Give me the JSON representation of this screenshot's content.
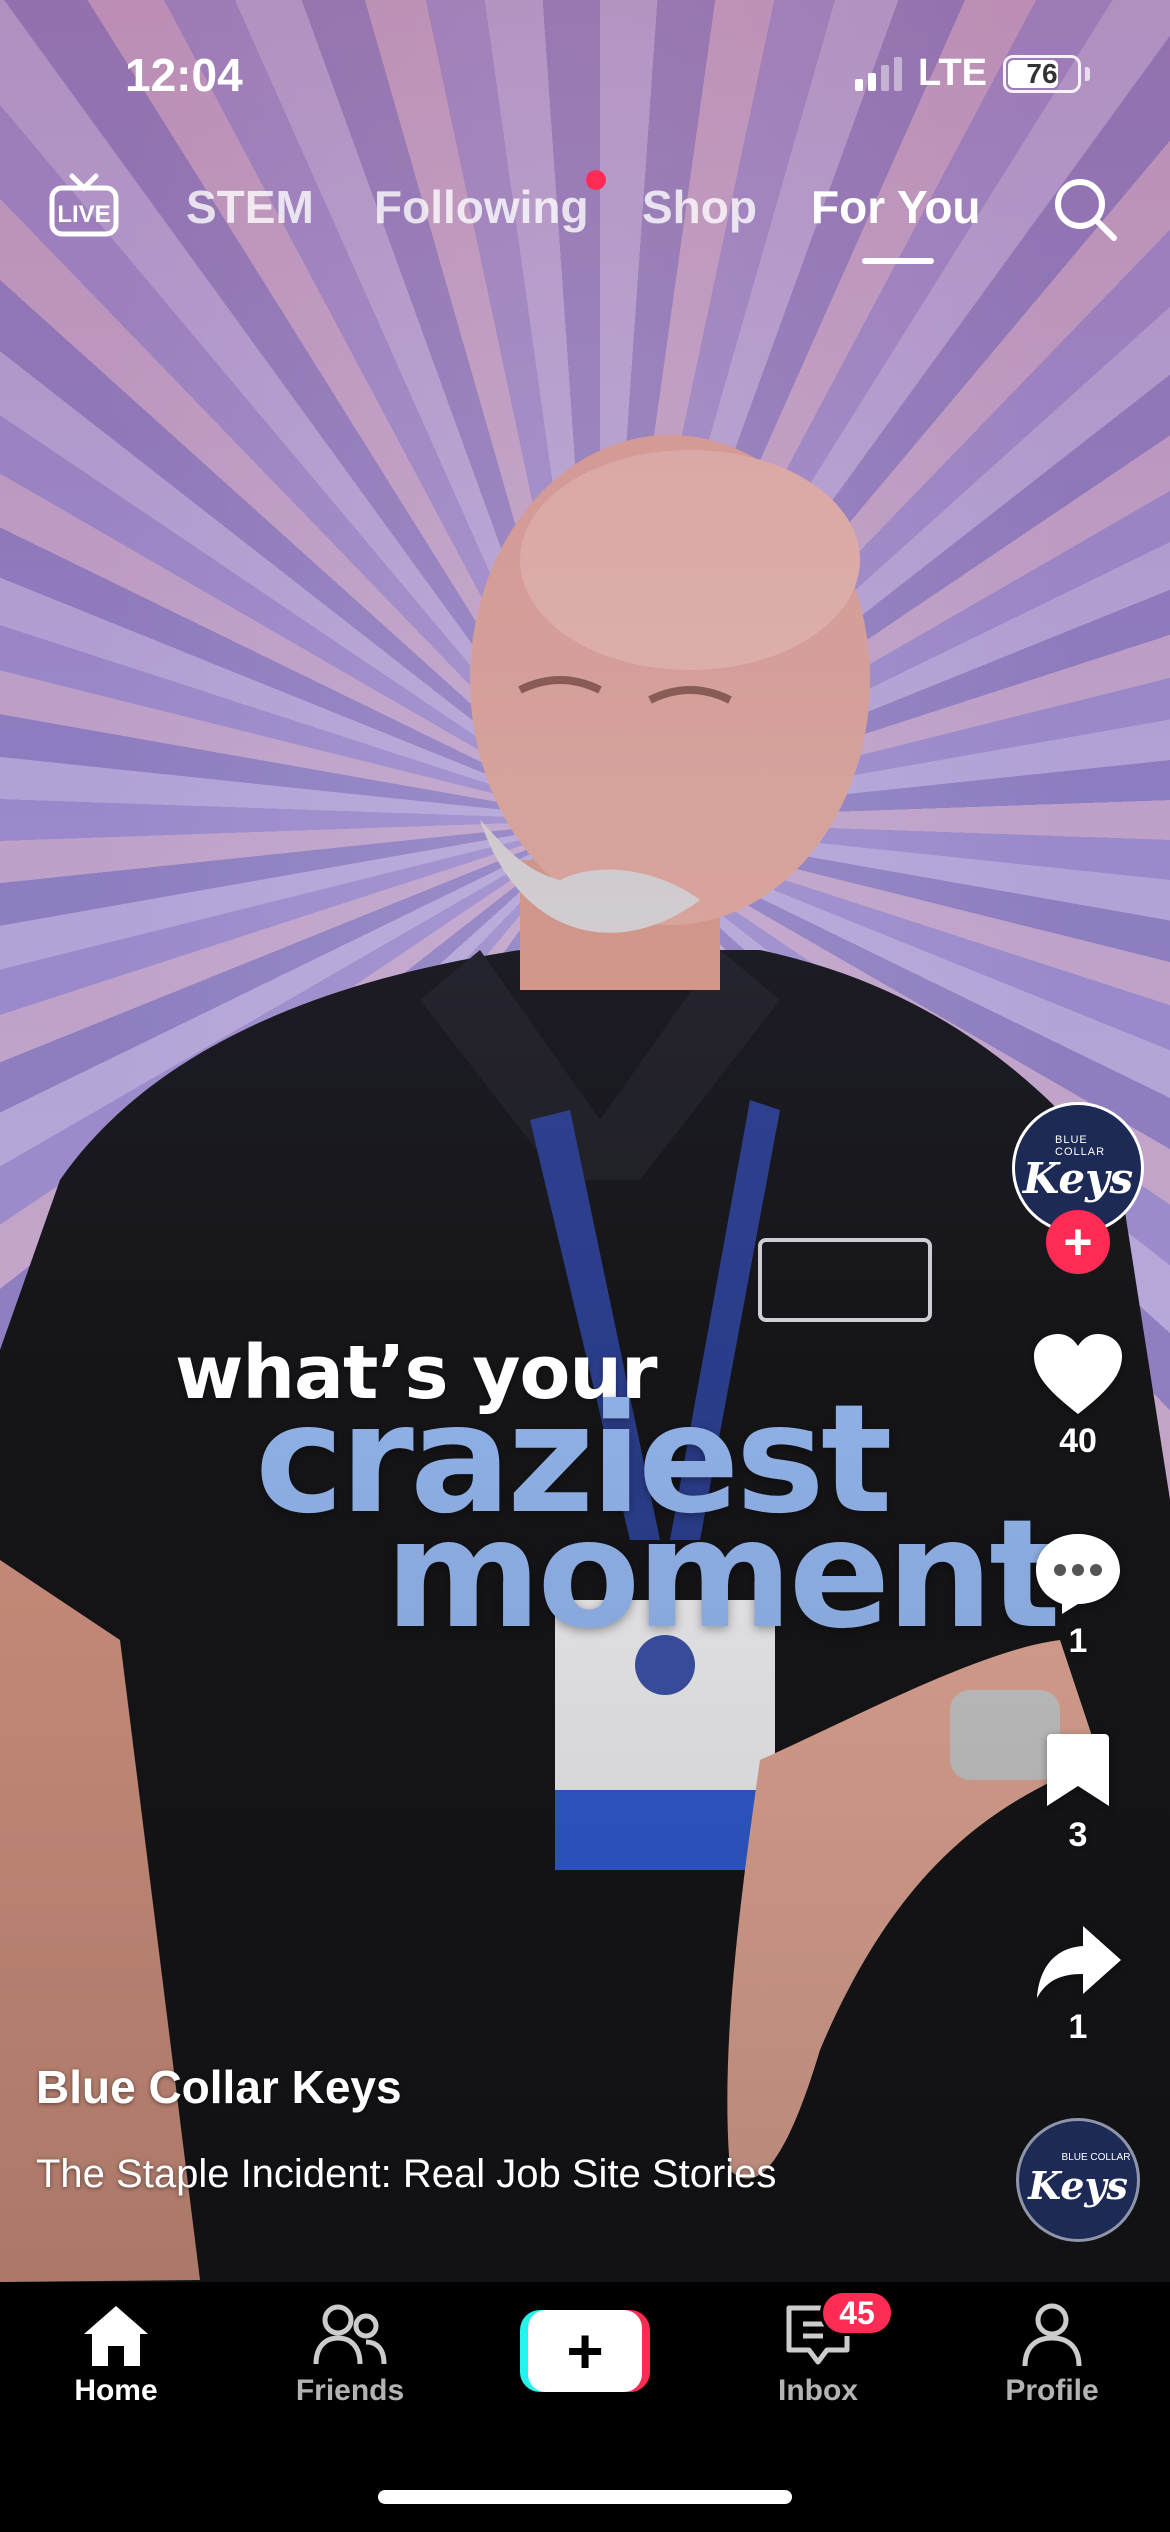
{
  "status_bar": {
    "time": "12:04",
    "network": "LTE",
    "battery": "76",
    "battery_level": 0.76
  },
  "top_nav": {
    "live_icon": "live-tv-icon",
    "tabs": [
      {
        "label": "STEM",
        "active": false
      },
      {
        "label": "Following",
        "active": false,
        "has_notification_dot": true
      },
      {
        "label": "Shop",
        "active": false
      },
      {
        "label": "For You",
        "active": true
      }
    ],
    "search_icon": "search-icon"
  },
  "video": {
    "overlay_text": {
      "line1": "what’s your",
      "line2": "craziest",
      "line3": "moment"
    }
  },
  "creator": {
    "avatar_brand": "Keys",
    "avatar_brand_small": "BLUE COLLAR",
    "username": "Blue Collar Keys",
    "caption": "The Staple Incident: Real Job Site Stories"
  },
  "actions": {
    "likes": "40",
    "comments": "1",
    "saves": "3",
    "shares": "1"
  },
  "bottom_tabs": [
    {
      "label": "Home",
      "icon": "home-icon",
      "active": true
    },
    {
      "label": "Friends",
      "icon": "friends-icon",
      "active": false
    },
    {
      "label": "",
      "icon": "create-plus-icon",
      "active": false
    },
    {
      "label": "Inbox",
      "icon": "inbox-icon",
      "active": false,
      "badge": "45"
    },
    {
      "label": "Profile",
      "icon": "profile-icon",
      "active": false
    }
  ],
  "colors": {
    "accent_red": "#fe2c55",
    "accent_cyan": "#25f4ee",
    "overlay_blue": "#8fb0e6"
  }
}
